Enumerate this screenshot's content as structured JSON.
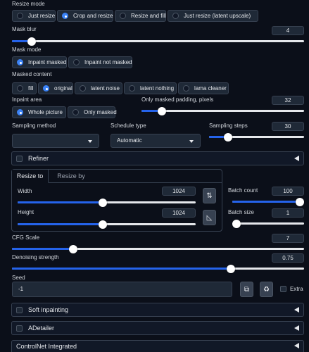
{
  "resize_mode": {
    "label": "Resize mode",
    "options": [
      "Just resize",
      "Crop and resize",
      "Resize and fill",
      "Just resize (latent upscale)"
    ],
    "selected": "Crop and resize"
  },
  "mask_blur": {
    "label": "Mask blur",
    "value": "4",
    "fraction": 0.067
  },
  "mask_mode": {
    "label": "Mask mode",
    "options": [
      "Inpaint masked",
      "Inpaint not masked"
    ],
    "selected": "Inpaint masked"
  },
  "masked_content": {
    "label": "Masked content",
    "options": [
      "fill",
      "original",
      "latent noise",
      "latent nothing",
      "lama cleaner"
    ],
    "selected": "original"
  },
  "inpaint_area": {
    "label": "Inpaint area",
    "options": [
      "Whole picture",
      "Only masked"
    ],
    "selected": "Whole picture"
  },
  "only_masked_padding": {
    "label": "Only masked padding, pixels",
    "value": "32",
    "fraction": 0.125
  },
  "sampling_method": {
    "label": "Sampling method",
    "value": ""
  },
  "schedule_type": {
    "label": "Schedule type",
    "value": "Automatic"
  },
  "sampling_steps": {
    "label": "Sampling steps",
    "value": "30",
    "fraction": 0.2
  },
  "refiner": {
    "label": "Refiner"
  },
  "resize_tabs": [
    "Resize to",
    "Resize by"
  ],
  "width": {
    "label": "Width",
    "value": "1024",
    "fraction": 0.48
  },
  "height": {
    "label": "Height",
    "value": "1024",
    "fraction": 0.48
  },
  "swap_icon": "⇅",
  "ratio_icon": "◺",
  "batch_count": {
    "label": "Batch count",
    "value": "100",
    "fraction": 1.0
  },
  "batch_size": {
    "label": "Batch size",
    "value": "1",
    "fraction": 0.0
  },
  "cfg_scale": {
    "label": "CFG Scale",
    "value": "7",
    "fraction": 0.21
  },
  "denoising": {
    "label": "Denoising strength",
    "value": "0.75",
    "fraction": 0.75
  },
  "seed": {
    "label": "Seed",
    "value": "-1",
    "extra_label": "Extra",
    "dice_icon": "⧉",
    "recycle_icon": "♻"
  },
  "accordions": {
    "soft_inpainting": "Soft inpainting",
    "adetailer": "ADetailer",
    "controlnet": "ControlNet Integrated"
  },
  "colors": {
    "accent": "#2563eb",
    "background": "#0b0f19",
    "panel": "#1f2937"
  }
}
